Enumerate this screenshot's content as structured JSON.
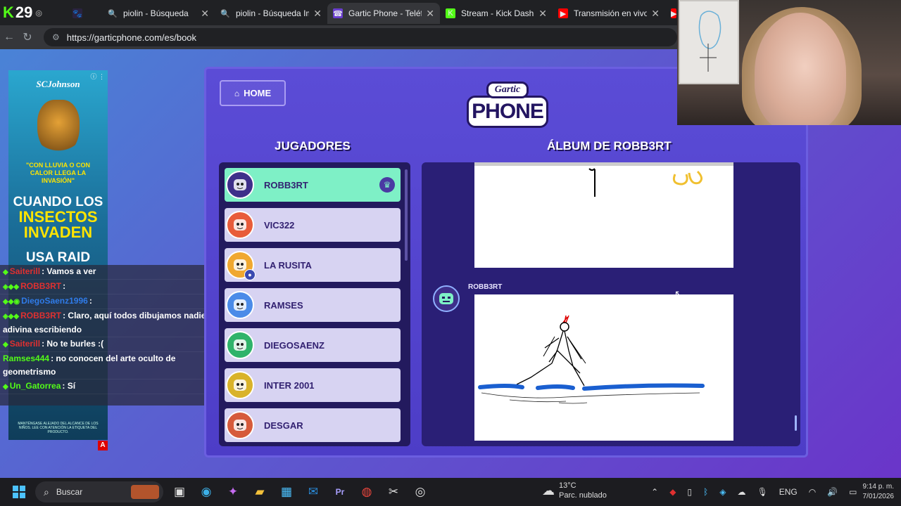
{
  "browser": {
    "viewers": "29",
    "tabs": [
      {
        "title": "",
        "fav": "🐾",
        "favbg": "#2a2340",
        "width": 50,
        "close": false
      },
      {
        "title": "piolin - Búsqueda",
        "fav": "🔍",
        "favbg": "transparent",
        "width": 160,
        "close": true
      },
      {
        "title": "piolin - Búsqueda Imág",
        "fav": "🔍",
        "favbg": "transparent",
        "width": 160,
        "close": true
      },
      {
        "title": "Gartic Phone - Teléfono",
        "fav": "☎",
        "favbg": "#6a3ecf",
        "width": 160,
        "close": true,
        "active": true
      },
      {
        "title": "Stream - Kick Dashboar",
        "fav": "K",
        "favbg": "#53fc18",
        "width": 160,
        "close": true
      },
      {
        "title": "Transmisión en vivo - Yo",
        "fav": "▶",
        "favbg": "#ff0000",
        "width": 160,
        "close": true
      },
      {
        "title": "F",
        "fav": "▶",
        "favbg": "#ff0000",
        "width": 30,
        "close": false
      }
    ],
    "url": "https://garticphone.com/es/book"
  },
  "ad": {
    "brand": "SCJohnson",
    "bubble": "\"CON LLUVIA O CON CALOR LLEGA LA INVASIÓN\"",
    "headline_1": "CUANDO LOS",
    "headline_2": "INSECTOS INVADEN",
    "headline_3": "USA RAID",
    "fine_print": "MANTÉNGASE ALEJADO DEL ALCANCE DE LOS NIÑOS. LEE CON ATENCIÓN LA ETIQUETA DEL PRODUCTO.",
    "badge": "A"
  },
  "chat": [
    {
      "icons": "◆",
      "user": "Saiterill",
      "ucolor": "#e03030",
      "text": ": Vamos a ver"
    },
    {
      "icons": "◈◆◆",
      "user": "ROBB3RT",
      "ucolor": "#e03030",
      "text": ":"
    },
    {
      "icons": "◆◆◉",
      "user": "DiegoSaenz1996",
      "ucolor": "#2f7be8",
      "text": ":"
    },
    {
      "icons": "◈◆◆",
      "user": "ROBB3RT",
      "ucolor": "#e03030",
      "text": ": Claro, aquí todos dibujamos nadie adivina escribiendo"
    },
    {
      "icons": "◆",
      "user": "Saiterill",
      "ucolor": "#e03030",
      "text": ": No te burles :("
    },
    {
      "icons": "",
      "user": "Ramses444",
      "ucolor": "#53fc18",
      "text": ": no conocen del arte oculto de geometrismo"
    },
    {
      "icons": "◆",
      "user": "Un_Gatorrea",
      "ucolor": "#53fc18",
      "text": ": Sí"
    }
  ],
  "game": {
    "home_label": "HOME",
    "logo_top": "Gartic",
    "logo_bottom": "PHONE",
    "players_title": "JUGADORES",
    "album_title": "ÁLBUM DE ROBB3RT",
    "players": [
      {
        "name": "ROBB3RT",
        "active": true,
        "avatar_color": "#3e2f8a",
        "host": true
      },
      {
        "name": "VIC322",
        "active": false,
        "avatar_color": "#e85c3a"
      },
      {
        "name": "LA RUSITA",
        "active": false,
        "avatar_color": "#f0a830",
        "badge": true
      },
      {
        "name": "RAMSES",
        "active": false,
        "avatar_color": "#4b8be8"
      },
      {
        "name": "DIEGOSAENZ",
        "active": false,
        "avatar_color": "#2fb36a"
      },
      {
        "name": "INTER 2001",
        "active": false,
        "avatar_color": "#d9b32a"
      },
      {
        "name": "DESGAR",
        "active": false,
        "avatar_color": "#d65b3b"
      }
    ],
    "album_author": "ROBB3RT"
  },
  "taskbar": {
    "search_label": "Buscar",
    "weather_temp": "13°C",
    "weather_desc": "Parc. nublado",
    "weather_badge": "2",
    "lang": "ENG",
    "time": "9:14 p. m.",
    "date": "7/01/2026"
  }
}
